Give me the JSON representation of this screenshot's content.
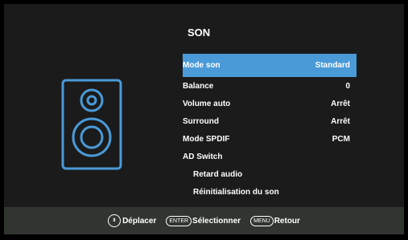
{
  "menu": {
    "title": "SON",
    "items": [
      {
        "label": "Mode son",
        "value": "Standard"
      },
      {
        "label": "Balance",
        "value": "0"
      },
      {
        "label": "Volume auto",
        "value": "Arrêt"
      },
      {
        "label": "Surround",
        "value": "Arrêt"
      },
      {
        "label": "Mode SPDIF",
        "value": "PCM"
      },
      {
        "label": "AD Switch",
        "value": ""
      },
      {
        "label": "Retard audio",
        "value": ""
      },
      {
        "label": "Réinitialisation du son",
        "value": ""
      }
    ]
  },
  "footer": {
    "move_label": "Déplacer",
    "enter_key": "ENTER",
    "select_label": "Sélectionner",
    "menu_key": "MENU",
    "back_label": "Retour"
  },
  "colors": {
    "highlight": "#4a9ad8",
    "icon": "#4a9ad8",
    "footer_bg": "#303530"
  },
  "icons": {
    "speaker": "speaker-icon",
    "navigate": "up-down-arrows-icon"
  }
}
